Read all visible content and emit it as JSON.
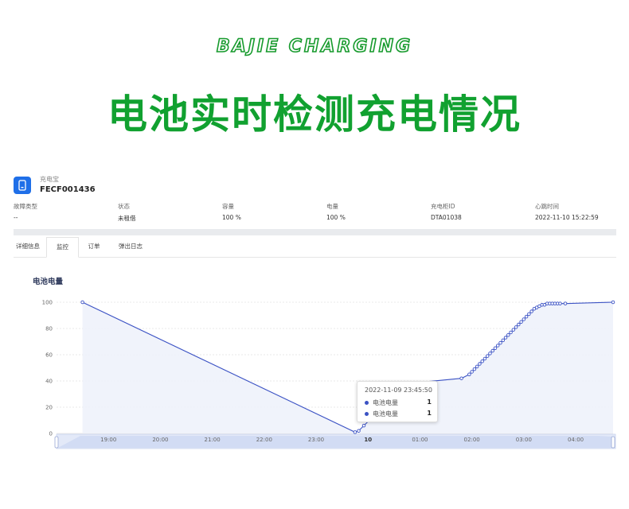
{
  "brand": "BAJIE CHARGING",
  "headline": "电池实时检测充电情况",
  "device": {
    "type_label": "充电宝",
    "id": "FECF001436",
    "icon": "power-bank-icon",
    "icon_color": "#1f6fe8"
  },
  "info": [
    {
      "label": "故障类型",
      "value": "--"
    },
    {
      "label": "状态",
      "value": "未租借"
    },
    {
      "label": "容量",
      "value": "100 %"
    },
    {
      "label": "电量",
      "value": "100 %"
    },
    {
      "label": "充电柜ID",
      "value": "DTA01038"
    },
    {
      "label": "心跳时间",
      "value": "2022-11-10 15:22:59"
    }
  ],
  "tabs": [
    "详细信息",
    "监控",
    "订单",
    "弹出日志"
  ],
  "active_tab": "监控",
  "chart_title": "电池电量",
  "tooltip": {
    "time": "2022-11-09 23:45:50",
    "rows": [
      {
        "name": "电池电量",
        "value": "1"
      },
      {
        "name": "电池电量",
        "value": "1"
      }
    ]
  },
  "colors": {
    "brand_green": "#11a130",
    "line": "#3b52c4",
    "area_fill": "#eef2fb"
  },
  "chart_data": {
    "type": "line",
    "title": "电池电量",
    "xlabel": "",
    "ylabel": "",
    "ylim": [
      0,
      100
    ],
    "yticks": [
      0,
      20,
      40,
      60,
      80,
      100
    ],
    "xticks": [
      "19:00",
      "20:00",
      "21:00",
      "22:00",
      "23:00",
      "10",
      "01:00",
      "02:00",
      "03:00",
      "04:00"
    ],
    "x_hours_since_1800": [
      0.5,
      5.75,
      5.82,
      5.92,
      6.75,
      7.8,
      7.95,
      8.0,
      8.05,
      8.1,
      8.15,
      8.2,
      8.25,
      8.3,
      8.35,
      8.4,
      8.45,
      8.5,
      8.55,
      8.6,
      8.65,
      8.7,
      8.75,
      8.8,
      8.85,
      8.9,
      8.95,
      9.0,
      9.05,
      9.1,
      9.15,
      9.2,
      9.25,
      9.3,
      9.35,
      9.4,
      9.45,
      9.5,
      9.55,
      9.6,
      9.65,
      9.7,
      9.8,
      10.72
    ],
    "series": [
      {
        "values": [
          100,
          1,
          2,
          6,
          38,
          42,
          45,
          47,
          49,
          51,
          53,
          55,
          57,
          59,
          61,
          63,
          65,
          67,
          69,
          71,
          73,
          75,
          77,
          79,
          81,
          83,
          85,
          87,
          89,
          91,
          93,
          95,
          96,
          97,
          98,
          98,
          99,
          99,
          99,
          99,
          99,
          99,
          99,
          100
        ]
      }
    ],
    "grid": true,
    "legend": "none"
  }
}
